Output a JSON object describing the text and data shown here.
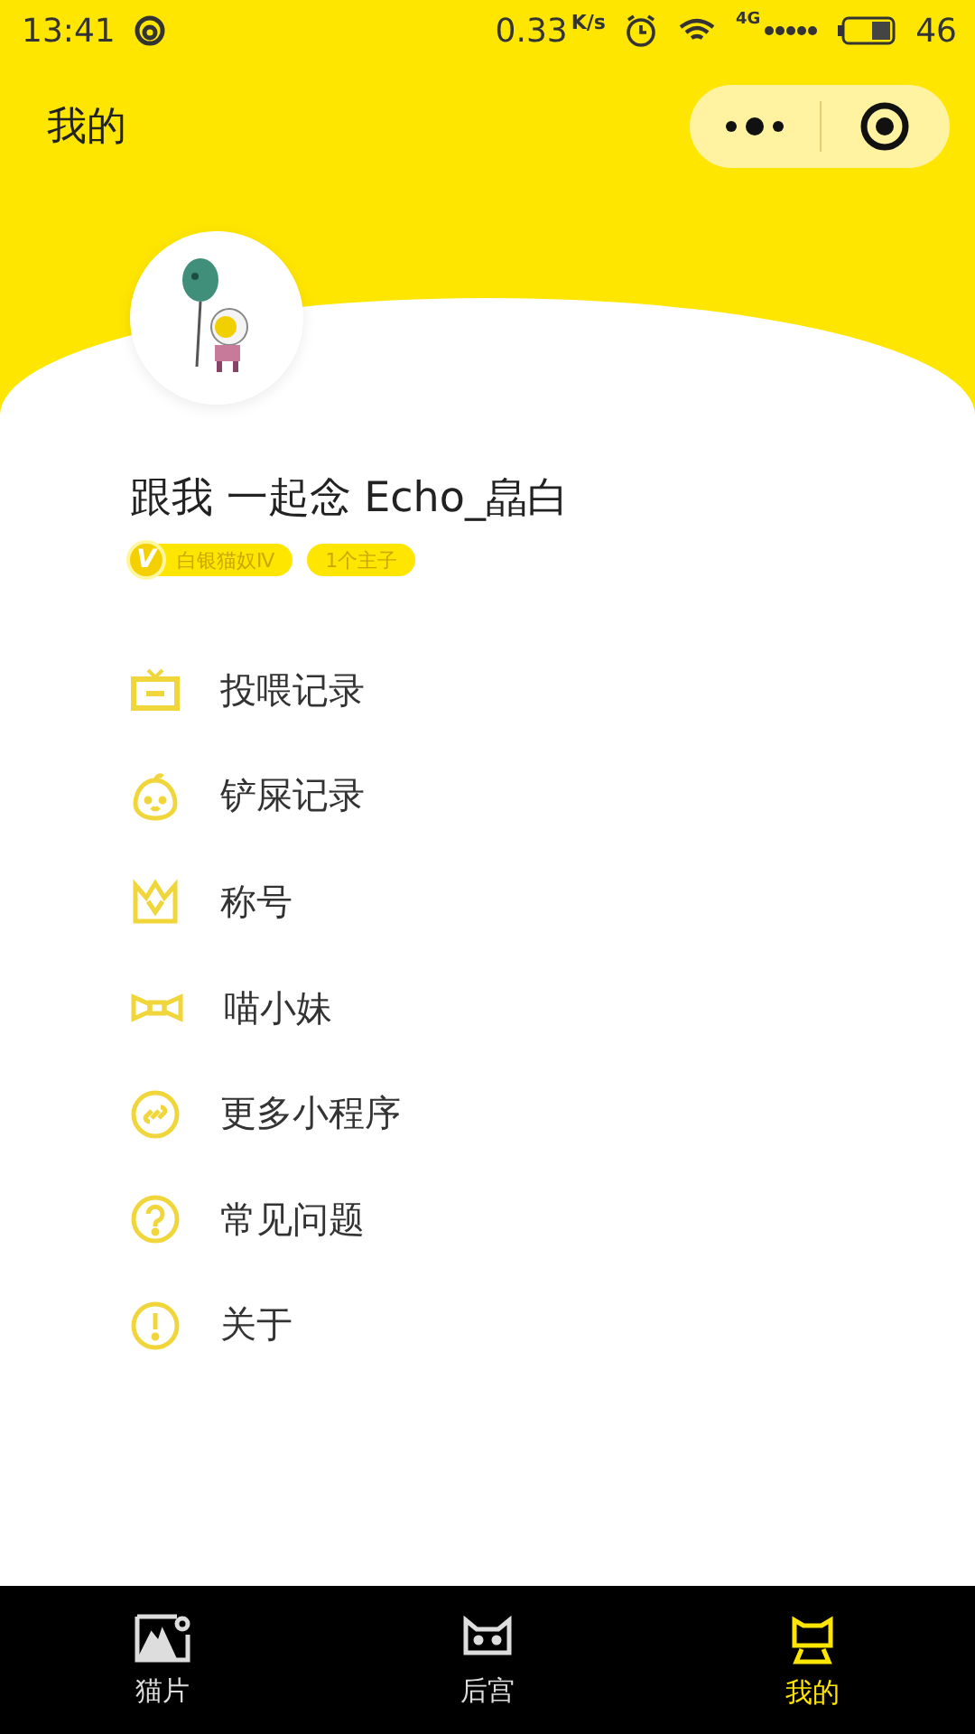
{
  "status_bar": {
    "time": "13:41",
    "speed": "0.33",
    "speed_unit": "K/s",
    "network": "4G",
    "battery": "46"
  },
  "nav": {
    "title": "我的"
  },
  "profile": {
    "name": "跟我 一起念 Echo_皛白",
    "level_badge": {
      "mark": "V",
      "label": "白银猫奴Ⅳ"
    },
    "count_badge": "1个主子"
  },
  "menu": [
    {
      "label": "投喂记录"
    },
    {
      "label": "铲屎记录"
    },
    {
      "label": "称号"
    },
    {
      "label": "喵小妹"
    },
    {
      "label": "更多小程序"
    },
    {
      "label": "常见问题"
    },
    {
      "label": "关于"
    }
  ],
  "tab_bar": [
    {
      "label": "猫片",
      "selected": false
    },
    {
      "label": "后宫",
      "selected": false
    },
    {
      "label": "我的",
      "selected": true
    }
  ]
}
